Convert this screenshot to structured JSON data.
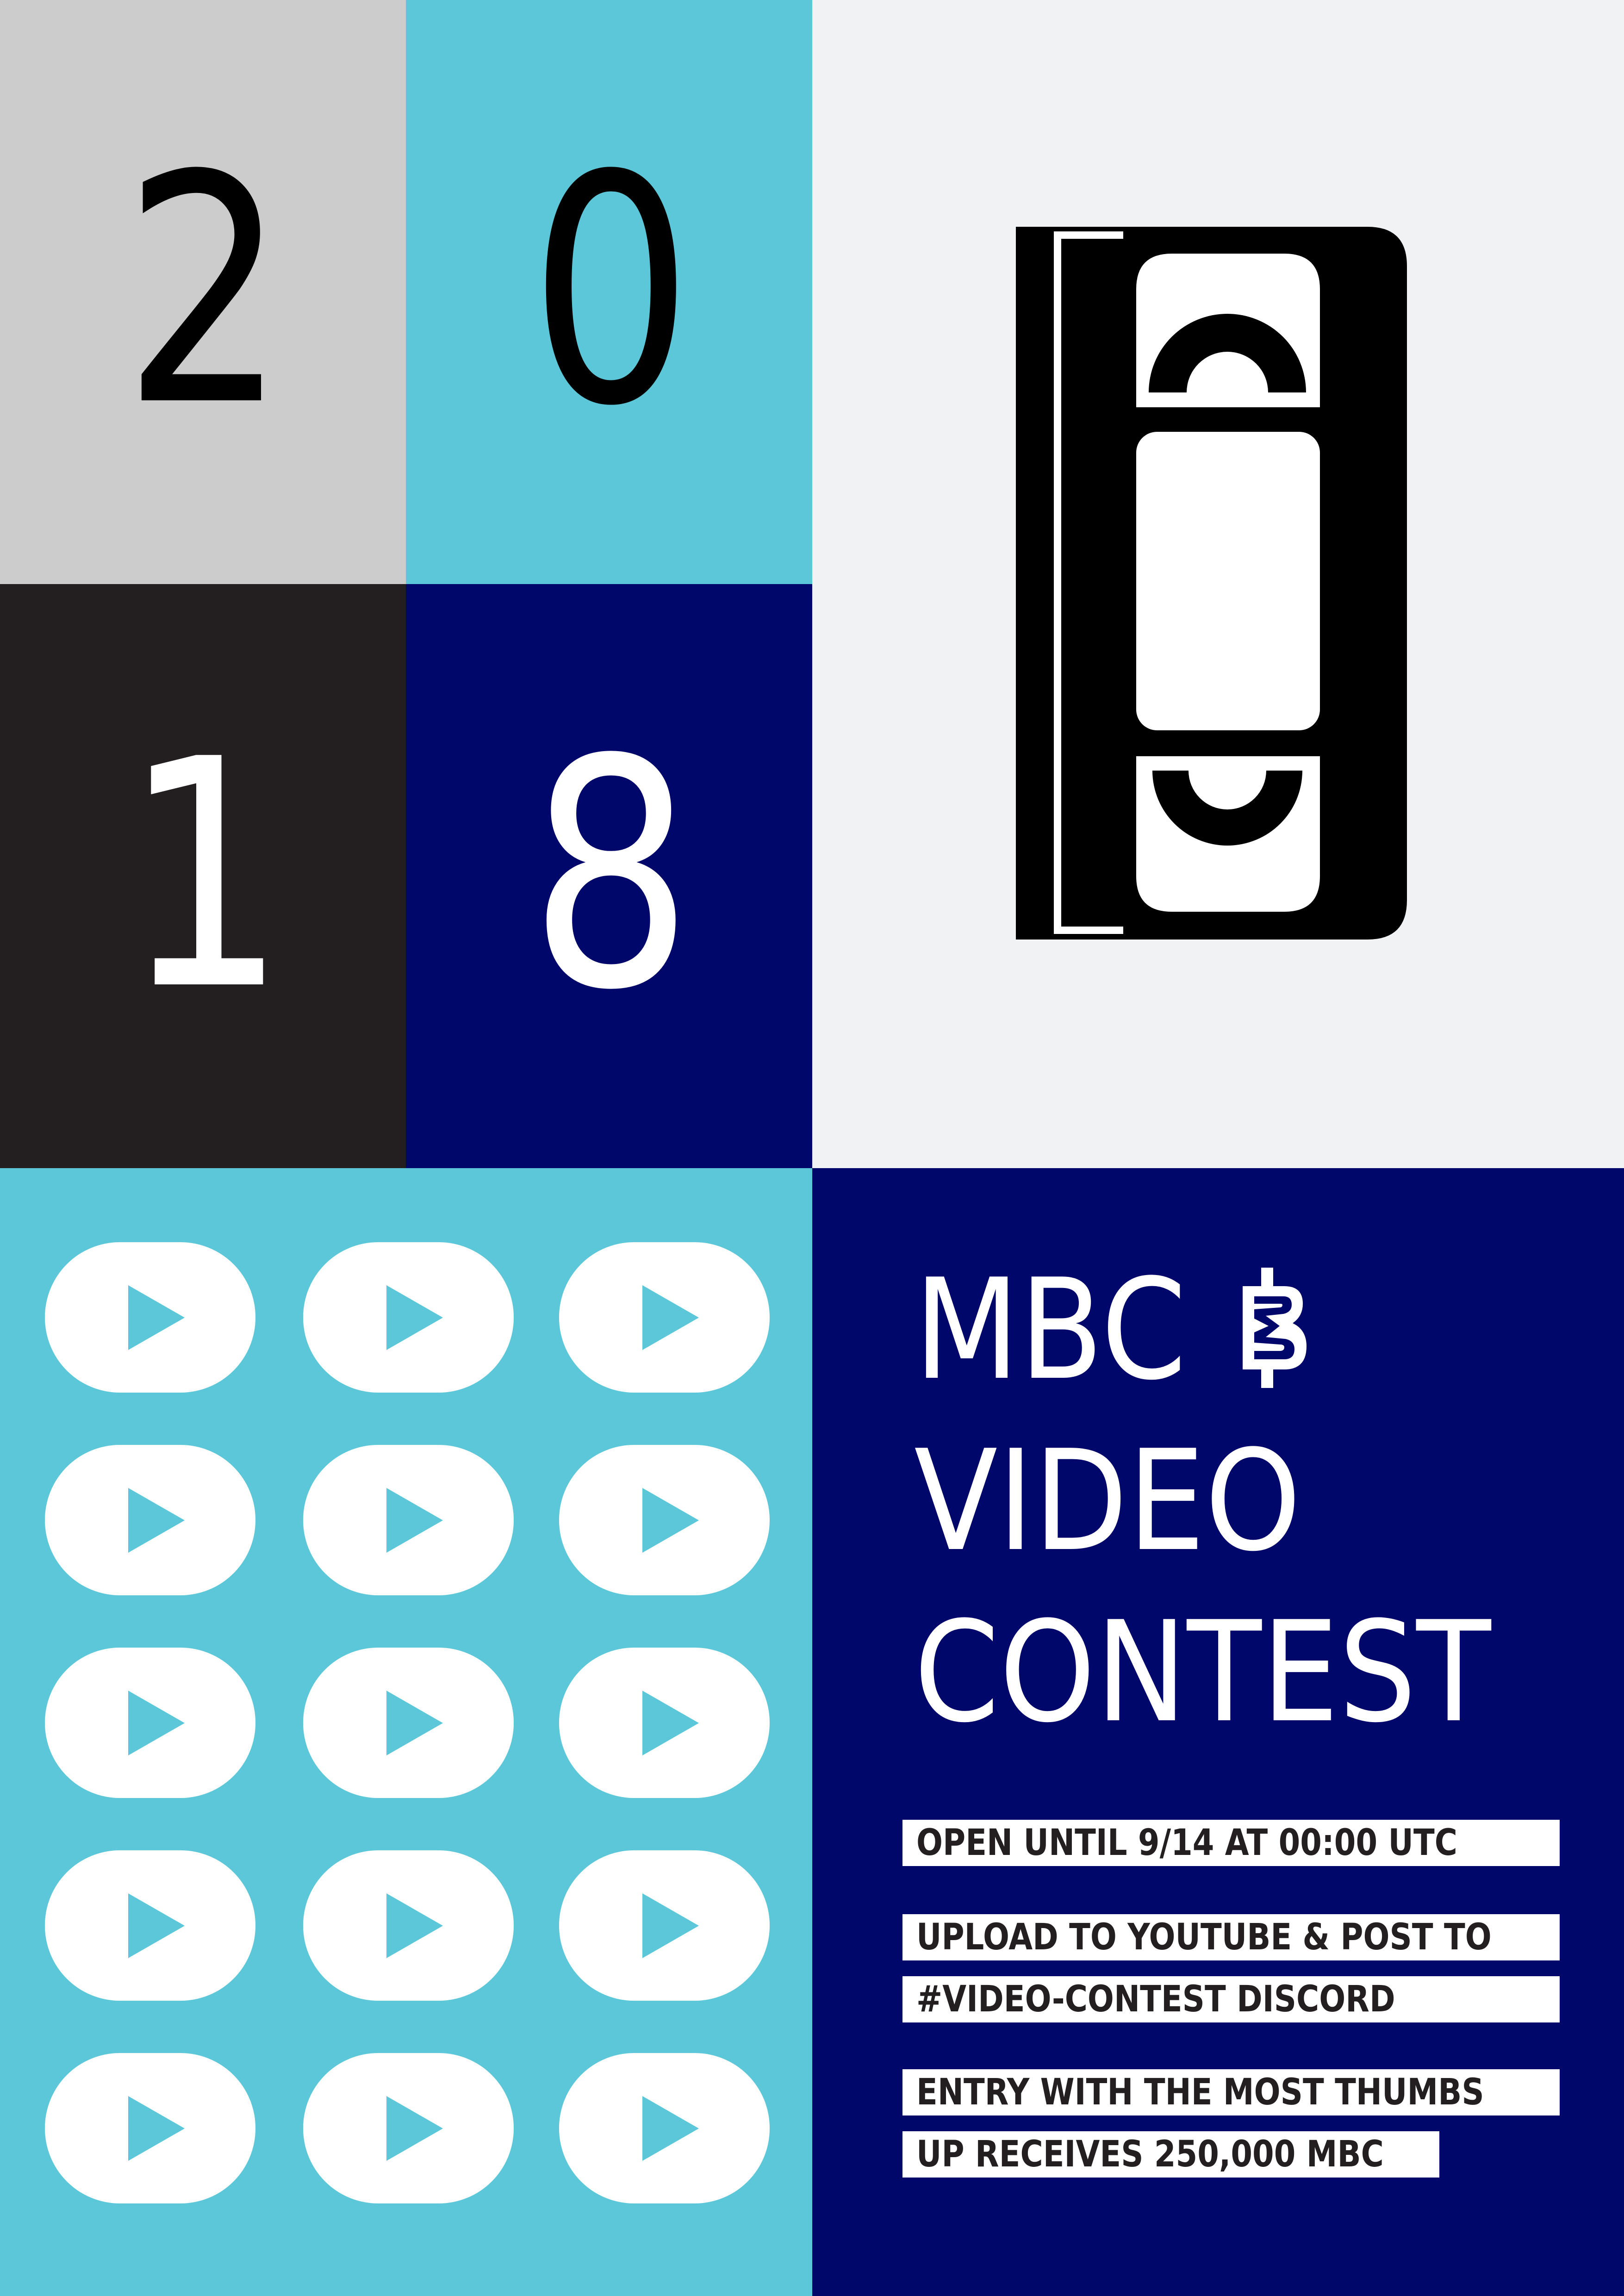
{
  "year": {
    "digits": [
      "2",
      "0",
      "1",
      "8"
    ]
  },
  "title": {
    "line1": "MBC",
    "line2": "VIDEO",
    "line3": "CONTEST"
  },
  "info": {
    "deadline": "OPEN UNTIL 9/14 AT 00:00 UTC",
    "instructions_line1": "UPLOAD TO YOUTUBE & POST TO",
    "instructions_line2": "#VIDEO-CONTEST DISCORD",
    "prize_line1": "ENTRY WITH THE MOST THUMBS",
    "prize_line2": "UP RECEIVES 250,000 MBC"
  },
  "icons": {
    "cassette": "vhs-cassette-icon",
    "play": "play-button-icon",
    "coin": "mbc-coin-icon"
  },
  "play_grid": {
    "rows": 5,
    "cols": 3
  },
  "colors": {
    "light_gray": "#cccccc",
    "cyan": "#5bc7d9",
    "charcoal": "#231f20",
    "navy": "#00076b",
    "off_white": "#f1f2f4"
  }
}
